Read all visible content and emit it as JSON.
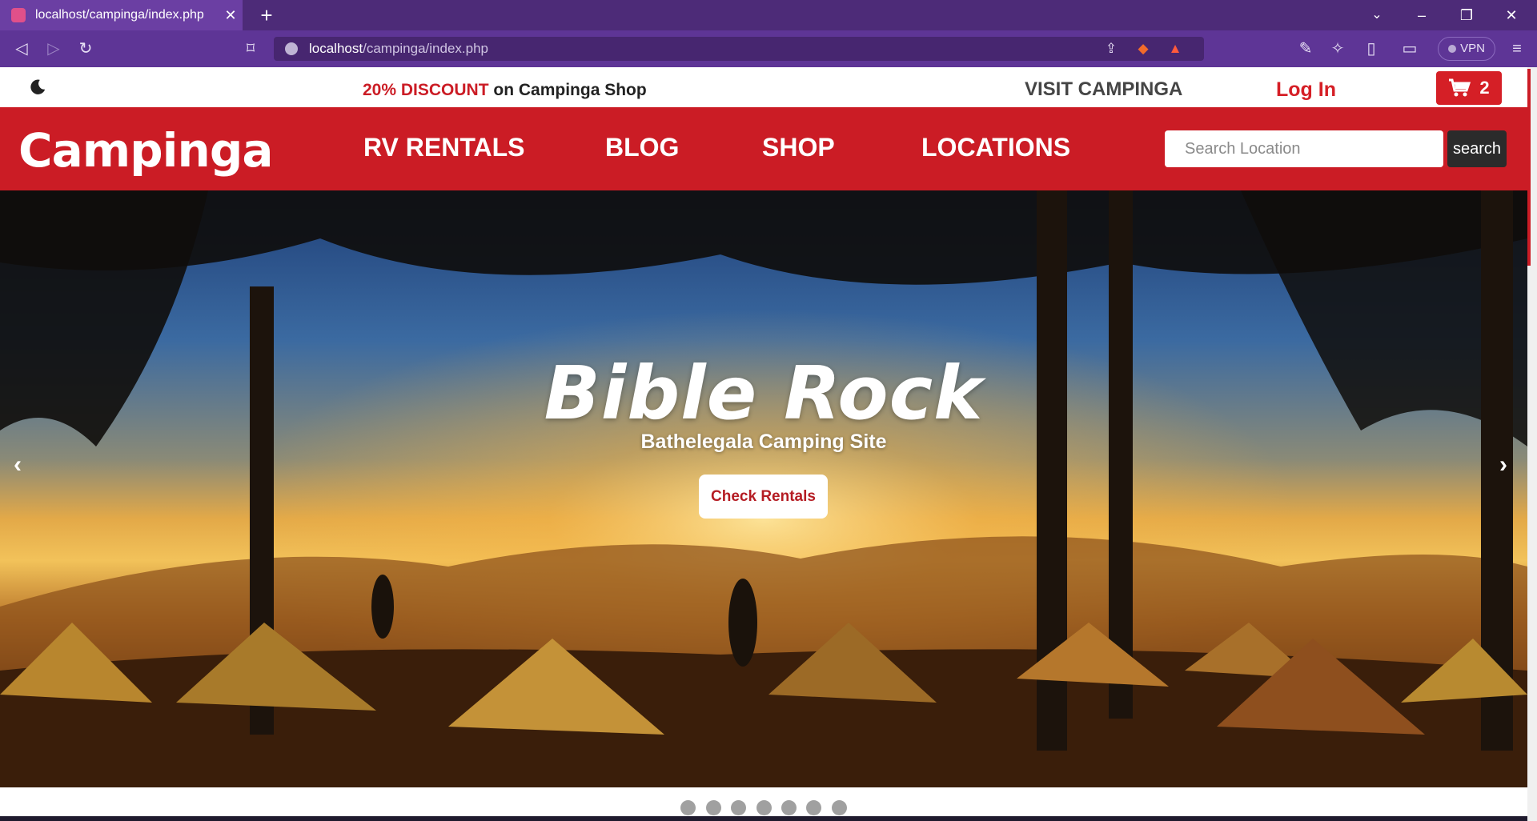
{
  "browser": {
    "tab_title": "localhost/campinga/index.php",
    "url_host": "localhost",
    "url_path": "/campinga/index.php",
    "vpn_label": "VPN"
  },
  "topstrip": {
    "promo_highlight": "20% DISCOUNT",
    "promo_rest": " on Campinga Shop",
    "visit_label": "VISIT CAMPINGA",
    "login_label": "Log In",
    "cart_count": "2"
  },
  "nav": {
    "logo": "Campinga",
    "links": [
      "RV RENTALS",
      "BLOG",
      "SHOP",
      "LOCATIONS"
    ],
    "search_placeholder": "Search Location",
    "search_button": "search"
  },
  "hero": {
    "title": "Bible Rock",
    "subtitle": "Bathelegala Camping Site",
    "button": "Check Rentals",
    "prev": "‹",
    "next": "›",
    "slide_count": 7
  },
  "colors": {
    "brand_red": "#cb1c25",
    "browser_purple": "#5e3596"
  }
}
